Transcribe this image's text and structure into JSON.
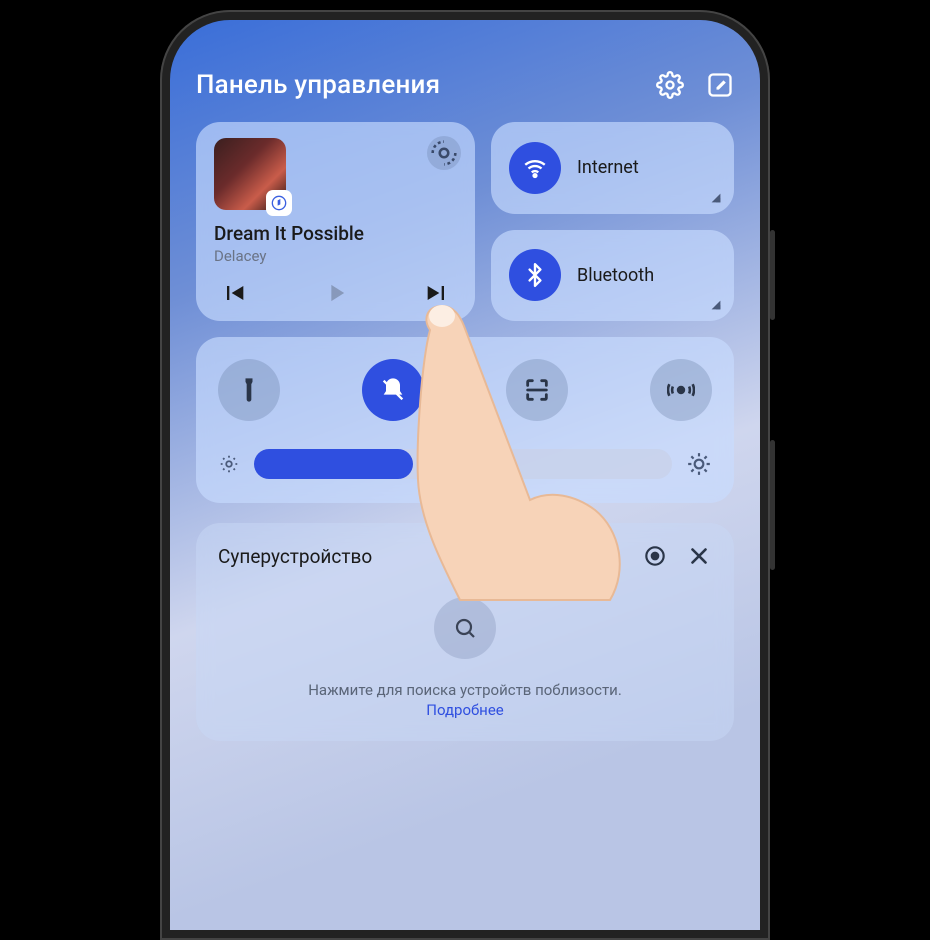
{
  "header": {
    "title": "Панель управления"
  },
  "music": {
    "track_title": "Dream It Possible",
    "artist": "Delacey"
  },
  "connectivity": {
    "internet_label": "Internet",
    "bluetooth_label": "Bluetooth"
  },
  "toggles": {
    "flashlight": "flashlight",
    "silent": "silent",
    "screenshot": "screenshot",
    "nearby": "nearby-share"
  },
  "brightness": {
    "percent": 38
  },
  "super_device": {
    "title": "Суперустройство",
    "message": "Нажмите для поиска устройств поблизости.",
    "link": "Подробнее"
  }
}
